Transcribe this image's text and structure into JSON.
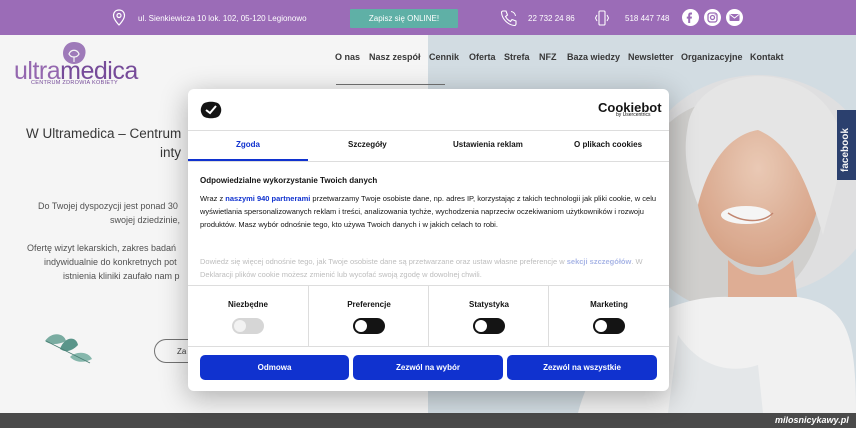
{
  "topbar": {
    "address": "ul. Sienkiewicza 10 lok. 102, 05-120 Legionowo",
    "book_label": "Zapisz się ONLINE!",
    "phone1": "22 732 24 86",
    "phone2": "518 447 748",
    "icons": [
      "location-pin-icon",
      "phone-icon",
      "mobile-phone-icon",
      "facebook-icon",
      "instagram-icon",
      "mail-icon"
    ],
    "color": "#9b6cb7",
    "button_color": "#5fb0a6"
  },
  "logo": {
    "part1": "ultra",
    "part2": "medica",
    "tagline": "CENTRUM ZDROWIA KOBIETY"
  },
  "nav": {
    "items": [
      "O nas",
      "Nasz zespół",
      "Cennik",
      "Oferta",
      "Strefa",
      "NFZ",
      "Baza wiedzy",
      "Newsletter",
      "Organizacyjne",
      "Kontakt"
    ]
  },
  "hero": {
    "title_line1": "W Ultramedica – Centrum",
    "title_line2": "inty",
    "p1_line1": "Do Twojej dyspozycji jest ponad 30",
    "p1_line2": "swojej dziedzinie,",
    "p2_line1": "Ofertę wizyt lekarskich, zakres badań",
    "p2_line2": "indywidualnie do konkretnych pot",
    "p2_line3": "istnienia kliniki zaufało nam p",
    "button_label": "Za"
  },
  "facebook_tab": "facebook",
  "watermark": "milosnicykawy.pl",
  "cookie_dialog": {
    "brand": "Cookiebot",
    "brand_sub": "by Usercentrics",
    "tabs": [
      "Zgoda",
      "Szczegóły",
      "Ustawienia reklam",
      "O plikach cookies"
    ],
    "active_tab": "Zgoda",
    "heading": "Odpowiedzialne wykorzystanie Twoich danych",
    "body_pre": "Wraz z ",
    "body_link": "naszymi 940 partnerami",
    "body_post": " przetwarzamy Twoje osobiste dane, np. adres IP, korzystając z takich technologii jak pliki cookie, w celu wyświetlania spersonalizowanych reklam i treści, analizowania tychże, wychodzenia naprzeciw oczekiwaniom użytkowników i rozwoju produktów. Masz wybór odnośnie tego, kto używa Twoich danych i w jakich celach to robi.",
    "body2_pre": "Dowiedz się więcej odnośnie tego, jak Twoje osobiste dane są przetwarzane oraz ustaw własne preferencje w ",
    "body2_link": "sekcji szczegółów",
    "body2_post": ". W Deklaracji plików cookie możesz zmienić lub wycofać swoją zgodę w dowolnej chwili.",
    "toggles": [
      {
        "label": "Niezbędne",
        "on": true,
        "disabled": true
      },
      {
        "label": "Preferencje",
        "on": false,
        "disabled": false
      },
      {
        "label": "Statystyka",
        "on": false,
        "disabled": false
      },
      {
        "label": "Marketing",
        "on": false,
        "disabled": false
      }
    ],
    "buttons": {
      "deny": "Odmowa",
      "allow_selection": "Zezwól na wybór",
      "allow_all": "Zezwól na wszystkie"
    },
    "accent_color": "#1032cf"
  }
}
